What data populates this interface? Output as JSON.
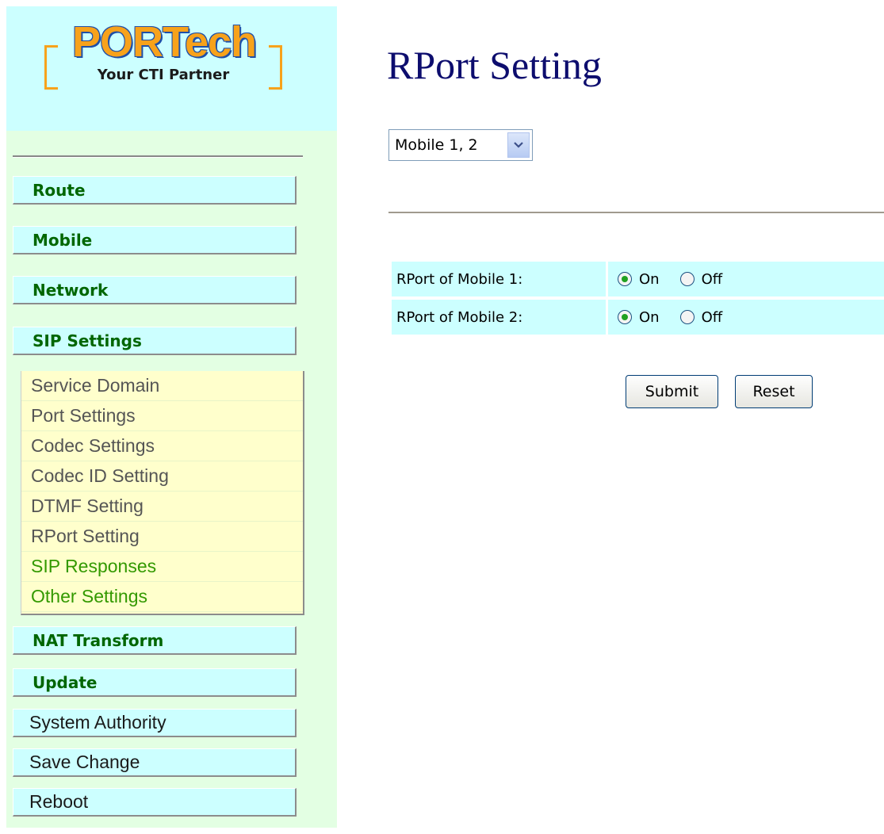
{
  "logo": {
    "brand": "PORTech",
    "tagline": "Your CTI Partner"
  },
  "sidebar": {
    "nav": [
      {
        "label": "Route"
      },
      {
        "label": "Mobile"
      },
      {
        "label": "Network"
      },
      {
        "label": "SIP Settings"
      }
    ],
    "sip_submenu": [
      {
        "label": "Service Domain",
        "color": "#555555"
      },
      {
        "label": "Port Settings",
        "color": "#555555"
      },
      {
        "label": "Codec Settings",
        "color": "#555555"
      },
      {
        "label": "Codec ID Setting",
        "color": "#555555"
      },
      {
        "label": "DTMF Setting",
        "color": "#555555"
      },
      {
        "label": "RPort Setting",
        "color": "#555555"
      },
      {
        "label": "SIP Responses",
        "color": "#339900"
      },
      {
        "label": "Other Settings",
        "color": "#339900"
      }
    ],
    "nav_bottom": [
      {
        "label": "NAT Transform"
      },
      {
        "label": "Update"
      }
    ],
    "plain_items": [
      {
        "label": "System Authority"
      },
      {
        "label": "Save Change"
      },
      {
        "label": "Reboot"
      }
    ]
  },
  "main": {
    "title": "RPort Setting",
    "mobile_select": {
      "value": "Mobile 1, 2"
    },
    "rows": [
      {
        "label": "RPort of Mobile 1:",
        "on_label": "On",
        "off_label": "Off",
        "selected": "On"
      },
      {
        "label": "RPort of Mobile 2:",
        "on_label": "On",
        "off_label": "Off",
        "selected": "On"
      }
    ],
    "submit_label": "Submit",
    "reset_label": "Reset"
  },
  "colors": {
    "sidebar_bg": "#e3ffe3",
    "nav_bg": "#ccffff",
    "nav_text": "#006600",
    "submenu_bg": "#ffffcc",
    "title_color": "#0d0d6e"
  }
}
